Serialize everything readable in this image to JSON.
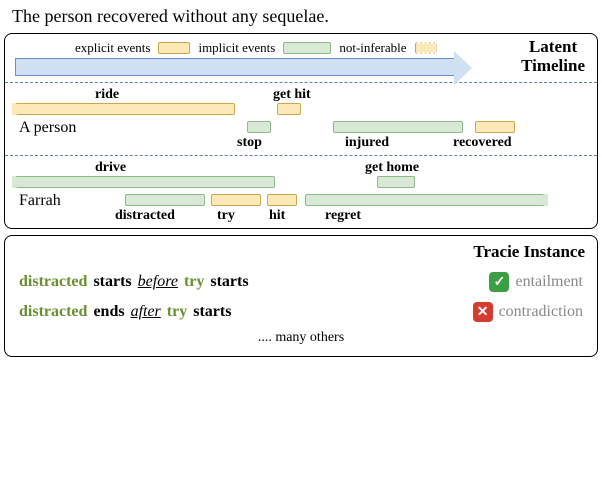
{
  "top_sentence": "The person recovered without any sequelae.",
  "legend": {
    "explicit": "explicit events",
    "implicit": "implicit events",
    "notinf": "not-inferable"
  },
  "latent_title_l1": "Latent",
  "latent_title_l2": "Timeline",
  "timeline": {
    "person": {
      "actor": "A person",
      "events": {
        "ride": "ride",
        "gethit": "get hit",
        "stop": "stop",
        "injured": "injured",
        "recovered": "recovered"
      }
    },
    "farrah": {
      "actor": "Farrah",
      "events": {
        "drive": "drive",
        "gethome": "get home",
        "distracted": "distracted",
        "try": "try",
        "hit": "hit",
        "regret": "regret"
      }
    }
  },
  "tracie": {
    "title": "Tracie Instance",
    "row1": {
      "a": "distracted",
      "v1": "starts",
      "rel": "before",
      "b": "try",
      "v2": "starts",
      "judgement": "entailment",
      "mark": "✓"
    },
    "row2": {
      "a": "distracted",
      "v1": "ends",
      "rel": "after",
      "b": "try",
      "v2": "starts",
      "judgement": "contradiction",
      "mark": "✕"
    },
    "others": ".... many others"
  },
  "caption_prefix": ""
}
